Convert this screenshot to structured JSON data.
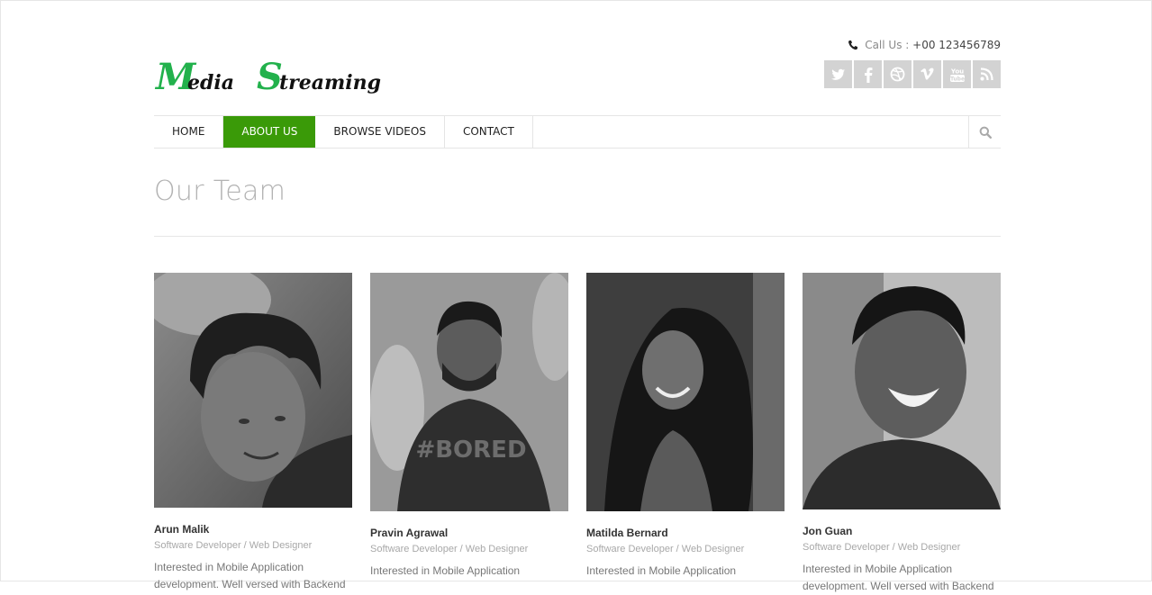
{
  "header": {
    "logo_text": "Media Streaming",
    "call_label": "Call Us :",
    "call_number": "+00 123456789",
    "social": [
      {
        "icon": "twitter-icon"
      },
      {
        "icon": "facebook-icon"
      },
      {
        "icon": "dribbble-icon"
      },
      {
        "icon": "vimeo-icon"
      },
      {
        "icon": "youtube-icon"
      },
      {
        "icon": "rss-icon"
      }
    ]
  },
  "nav": {
    "items": [
      {
        "label": "HOME",
        "active": false
      },
      {
        "label": "ABOUT US",
        "active": true
      },
      {
        "label": "BROWSE VIDEOS",
        "active": false
      },
      {
        "label": "CONTACT",
        "active": false
      }
    ]
  },
  "page": {
    "title": "Our Team"
  },
  "team": [
    {
      "name": "Arun Malik",
      "role": "Software Developer / Web Designer",
      "bio": "Interested in Mobile Application development. Well versed with Backend"
    },
    {
      "name": "Pravin Agrawal",
      "role": "Software Developer / Web Designer",
      "bio": "Interested in Mobile Application"
    },
    {
      "name": "Matilda Bernard",
      "role": "Software Developer / Web Designer",
      "bio": "Interested in Mobile Application"
    },
    {
      "name": "Jon Guan",
      "role": "Software Developer / Web Designer",
      "bio": "Interested in Mobile Application development. Well versed with Backend"
    }
  ],
  "colors": {
    "accent": "#3a9a08",
    "logo_green": "#22b14c"
  }
}
